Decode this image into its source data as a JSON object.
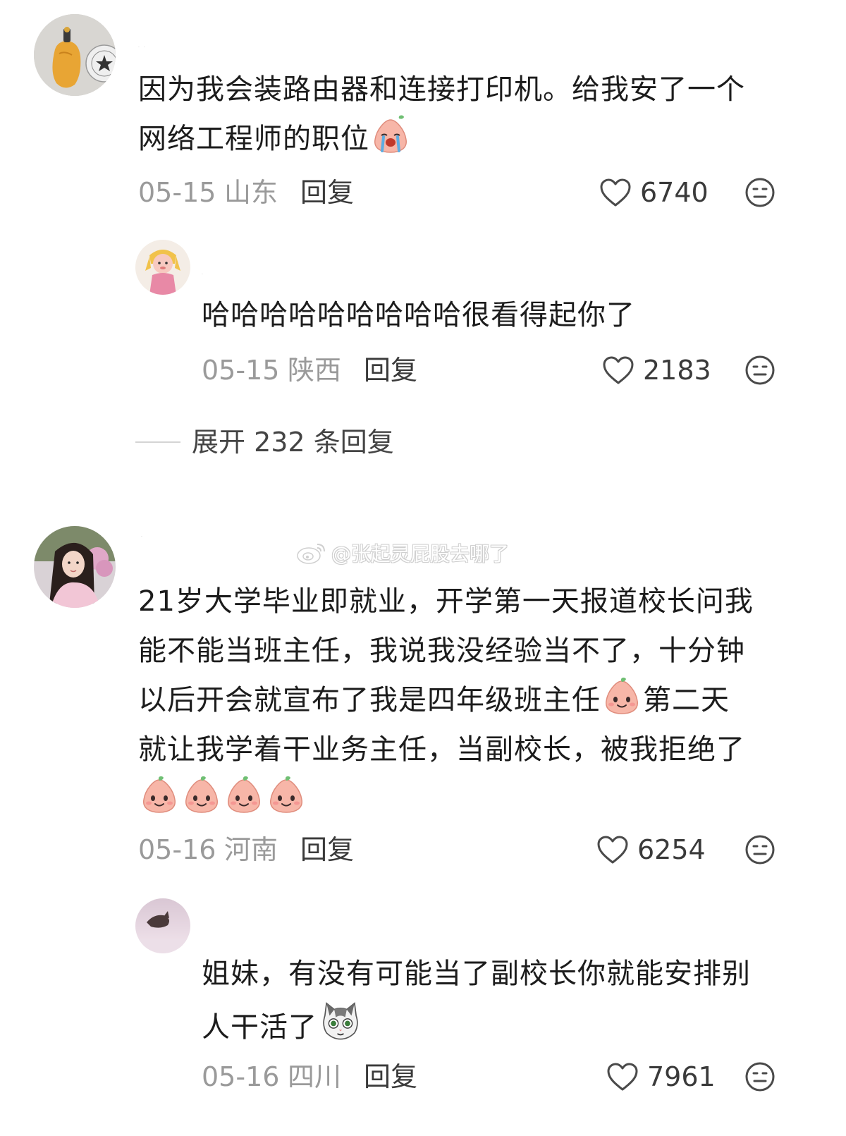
{
  "comments": [
    {
      "username": "·  ·",
      "lines": [
        "因为我会装路由器和连接打印机。给我安了一个",
        "网络工程师的职位"
      ],
      "emoji": "crying-peach-emoji",
      "date": "05-15",
      "location": "山东",
      "reply_label": "回复",
      "likes": "6740"
    },
    {
      "username": "·",
      "lines": [
        "哈哈哈哈哈哈哈哈哈很看得起你了"
      ],
      "date": "05-15",
      "location": "陕西",
      "reply_label": "回复",
      "likes": "2183"
    },
    {
      "username": "·",
      "lines": [
        "21岁大学毕业即就业，开学第一天报道校长问我",
        "能不能当班主任，我说我没经验当不了，十分钟",
        "以后开会就宣布了我是四年级班主任",
        "就让我学着干业务主任，当副校长，被我拒绝了"
      ],
      "line3_tail": "第二天",
      "emoji": "smiling-peach-emoji",
      "date": "05-16",
      "location": "河南",
      "reply_label": "回复",
      "likes": "6254"
    },
    {
      "username": "",
      "lines": [
        "姐妹，有没有可能当了副校长你就能安排别",
        "人干活了"
      ],
      "emoji": "cat-emoji",
      "date": "05-16",
      "location": "四川",
      "reply_label": "回复",
      "likes": "7961"
    }
  ],
  "expand": {
    "label": "展开 232 条回复"
  },
  "watermark": {
    "text": "@张起灵屁股去哪了",
    "icon": "weibo-icon"
  },
  "colors": {
    "meta_gray": "#9a9a9a",
    "text": "#1c1c1c",
    "peach": "#f7b6a8"
  }
}
